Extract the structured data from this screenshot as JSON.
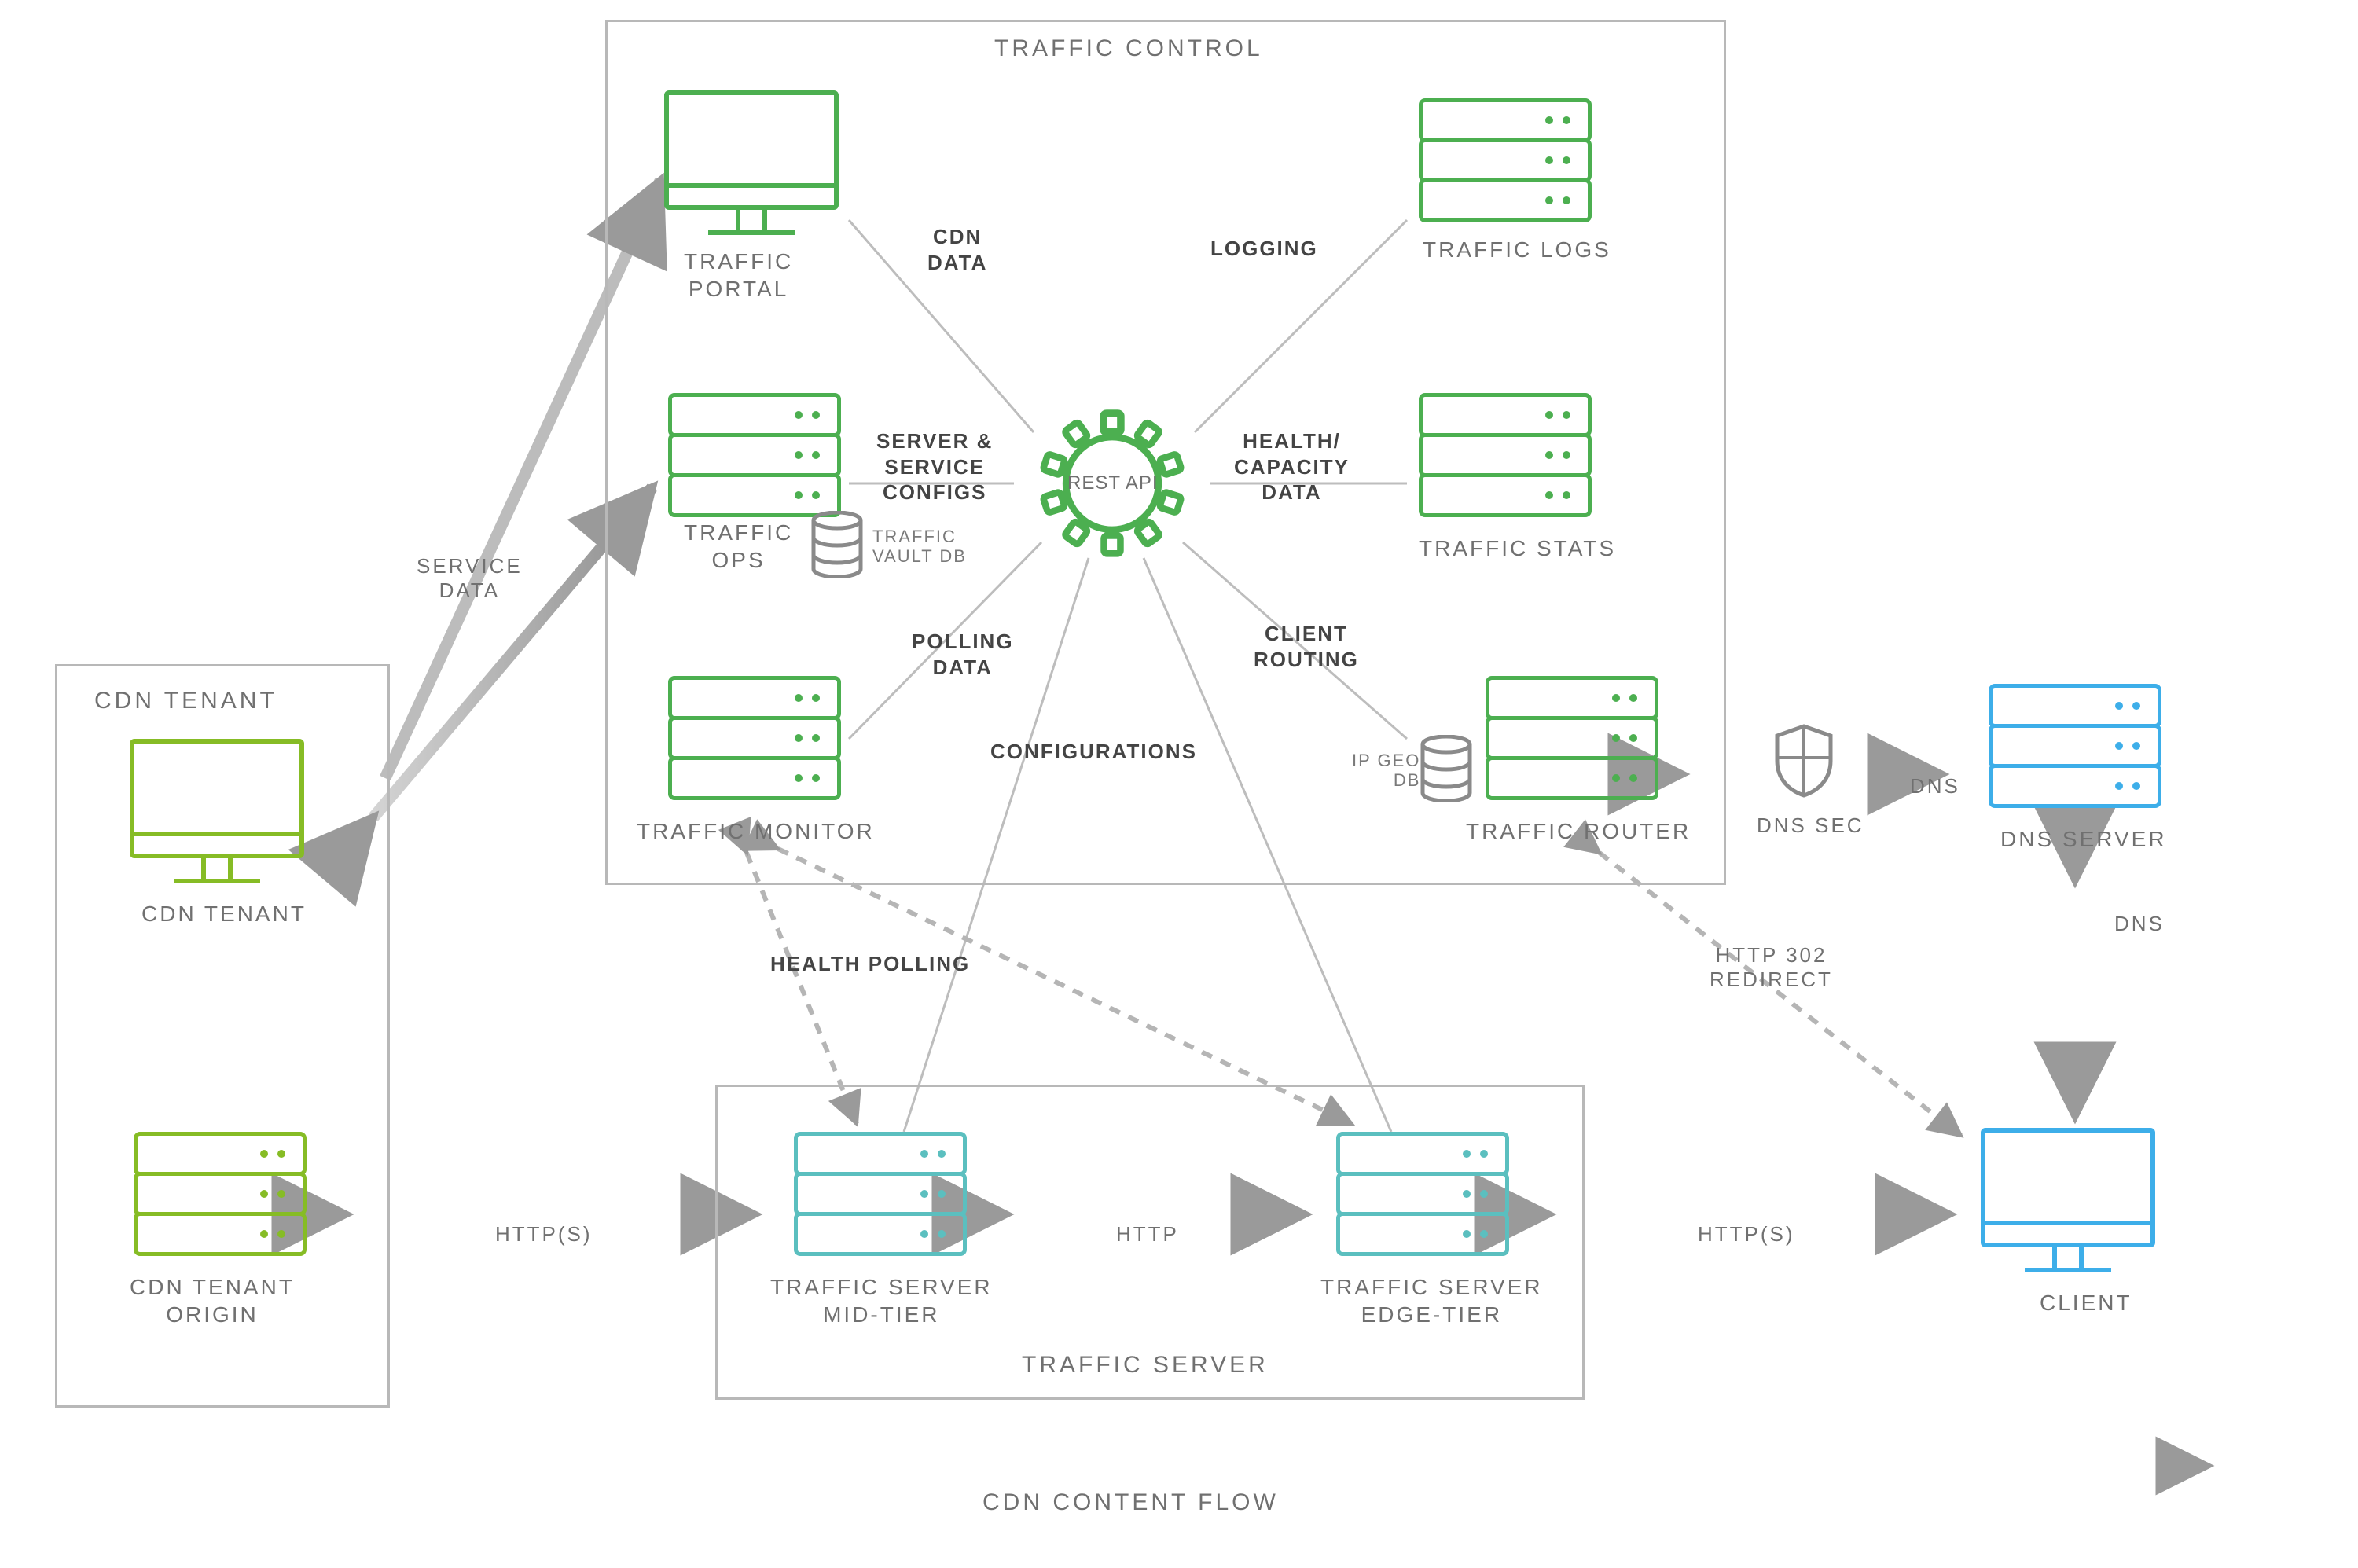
{
  "sections": {
    "traffic_control": "TRAFFIC CONTROL",
    "traffic_server": "TRAFFIC SERVER",
    "cdn_tenant": "CDN TENANT",
    "flow": "CDN CONTENT FLOW"
  },
  "nodes": {
    "traffic_portal": "TRAFFIC\nPORTAL",
    "traffic_ops": "TRAFFIC\nOPS",
    "traffic_monitor": "TRAFFIC MONITOR",
    "traffic_logs": "TRAFFIC LOGS",
    "traffic_stats": "TRAFFIC STATS",
    "traffic_router": "TRAFFIC ROUTER",
    "traffic_server_mid": "TRAFFIC SERVER\nMID-TIER",
    "traffic_server_edge": "TRAFFIC SERVER\nEDGE-TIER",
    "cdn_tenant": "CDN TENANT",
    "cdn_tenant_origin": "CDN TENANT\nORIGIN",
    "dns_server": "DNS SERVER",
    "client": "CLIENT",
    "rest_api": "REST API",
    "vault_db": "TRAFFIC\nVAULT DB",
    "ip_geo_db": "IP GEO\nDB"
  },
  "edges": {
    "service_data": "SERVICE\nDATA",
    "cdn_data": "CDN\nDATA",
    "logging": "LOGGING",
    "server_service_configs": "SERVER &\nSERVICE\nCONFIGS",
    "health_capacity_data": "HEALTH/\nCAPACITY\nDATA",
    "polling_data": "POLLING\nDATA",
    "client_routing": "CLIENT\nROUTING",
    "configurations": "CONFIGURATIONS",
    "health_polling": "HEALTH POLLING",
    "http_302_redirect": "HTTP 302\nREDIRECT",
    "dns_sec": "DNS SEC",
    "dns": "DNS",
    "http": "HTTP",
    "https_left": "HTTP(S)",
    "https_right": "HTTP(S)"
  },
  "colors": {
    "lime": "#86bc25",
    "green": "#4caf50",
    "teal": "#5bbfbf",
    "blue": "#3daee9",
    "gray_line": "#b8b8b8",
    "gray_text": "#707070"
  }
}
